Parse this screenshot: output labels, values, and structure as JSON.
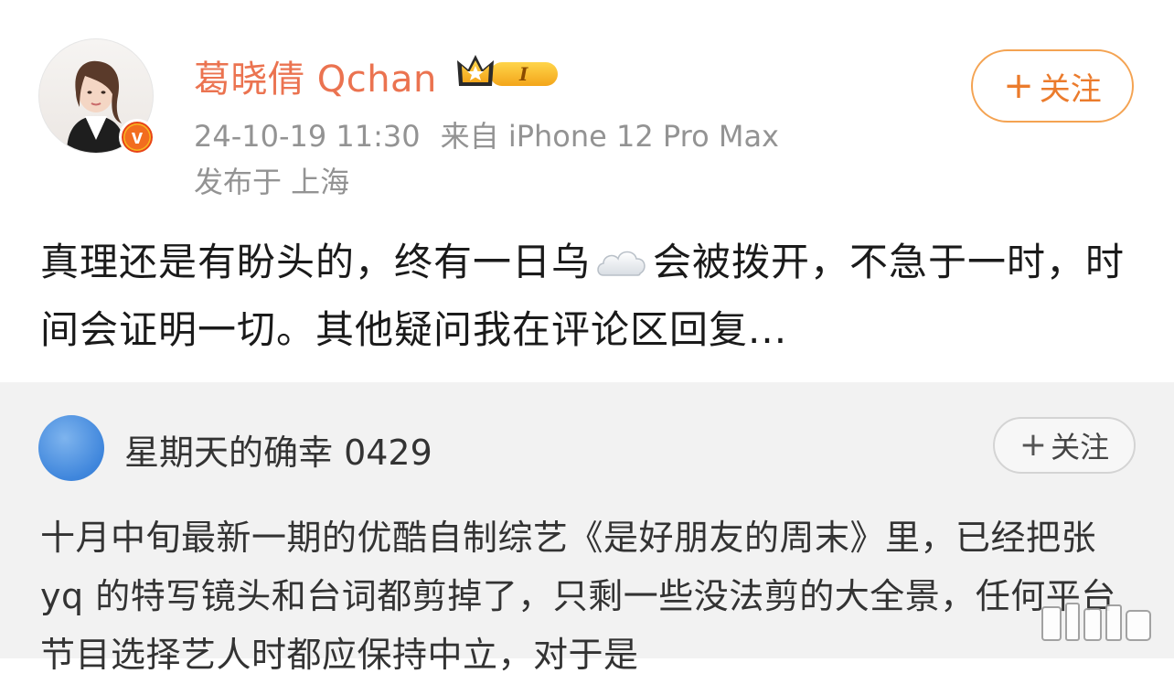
{
  "post": {
    "username": "葛晓倩 Qchan",
    "badge_level": "I",
    "timestamp": "24-10-19 11:30",
    "source": "来自 iPhone 12 Pro Max",
    "location": "发布于 上海",
    "follow_label": "关注",
    "text_part1": "真理还是有盼头的，终有一日乌",
    "text_part2": "会被拨开，不急于一时，时间会证明一切。其他疑问我在评论区回复...",
    "cloud_emoji": "cloud-emoji"
  },
  "repost": {
    "username": "星期天的确幸 0429",
    "follow_label": "关注",
    "text": "十月中旬最新一期的优酷自制综艺《是好朋友的周末》里，已经把张 yq 的特写镜头和台词都剪掉了，只剩一些没法剪的大全景，任何平台节目选择艺人时都应保持中立，对于是"
  },
  "colors": {
    "username": "#eb7350",
    "follow_border": "#f4a352",
    "meta_text": "#939393",
    "repost_bg": "#f2f2f2"
  },
  "icons": {
    "verified_badge": "verified-v-icon",
    "crown_badge": "crown-icon",
    "watermark": "weibo-watermark-icon"
  }
}
